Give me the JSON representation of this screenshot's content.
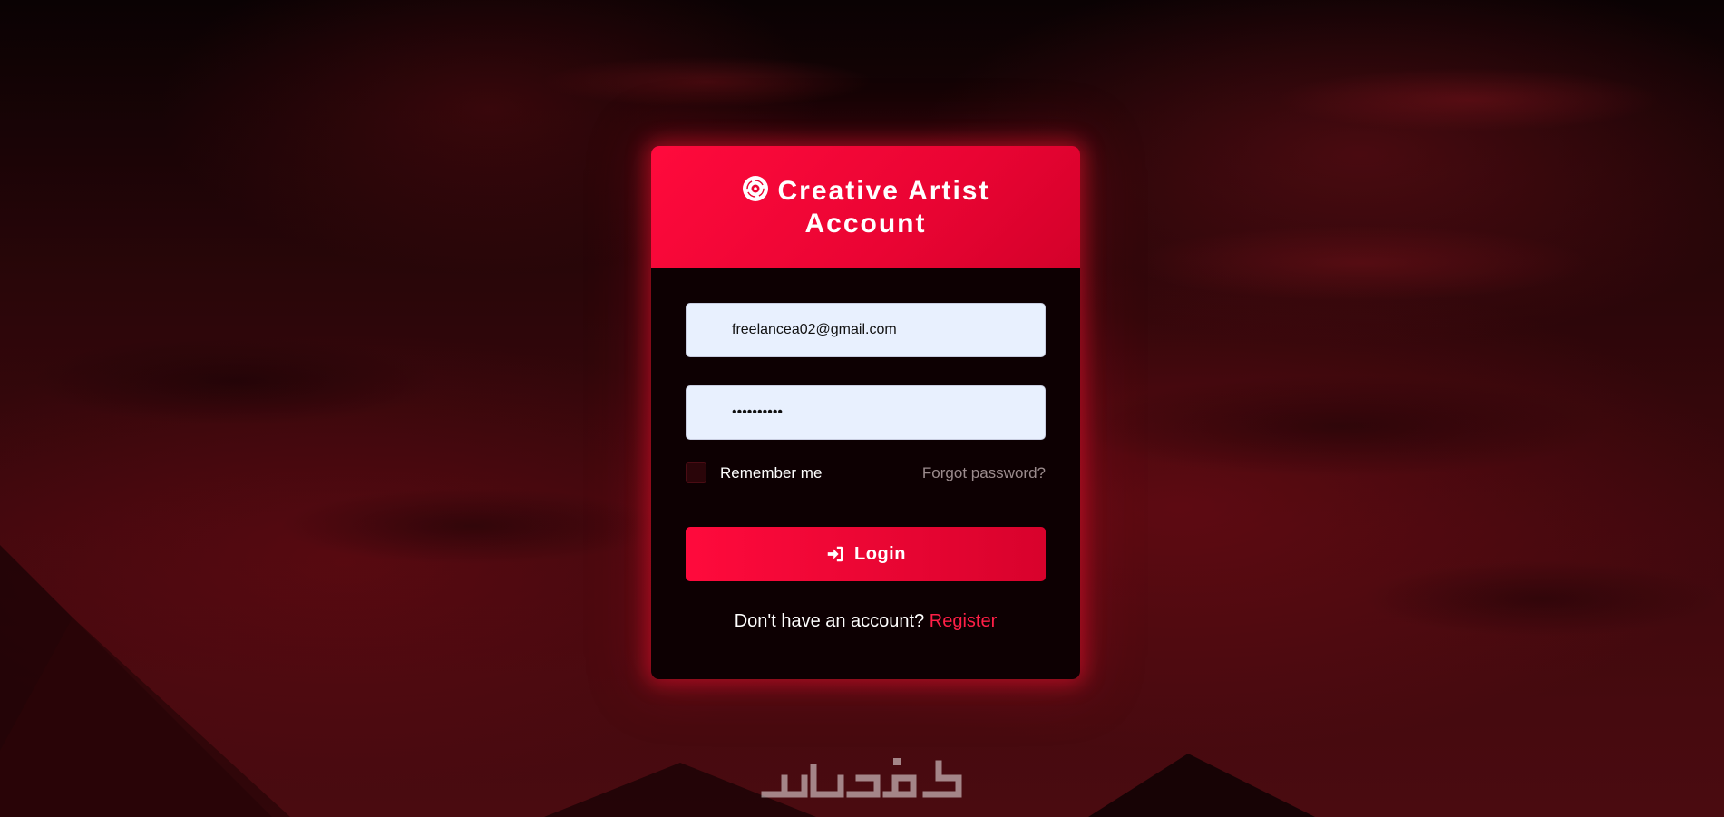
{
  "header": {
    "title": "Creative Artist Account",
    "icon": "vinyl-record-icon"
  },
  "form": {
    "email_value": "freelancea02@gmail.com",
    "password_value": "••••••••••",
    "remember_label": "Remember me",
    "remember_checked": false,
    "forgot_label": "Forgot password?",
    "login_label": "Login",
    "login_icon": "sign-in-icon",
    "register_prompt": "Don't have an account?",
    "register_label": "Register"
  },
  "watermark": {
    "text": "خمسات"
  },
  "colors": {
    "accent": "#ff0a3c",
    "card_bg": "#0d0002",
    "input_bg": "#e8f0fe",
    "link": "#ff1f47"
  }
}
